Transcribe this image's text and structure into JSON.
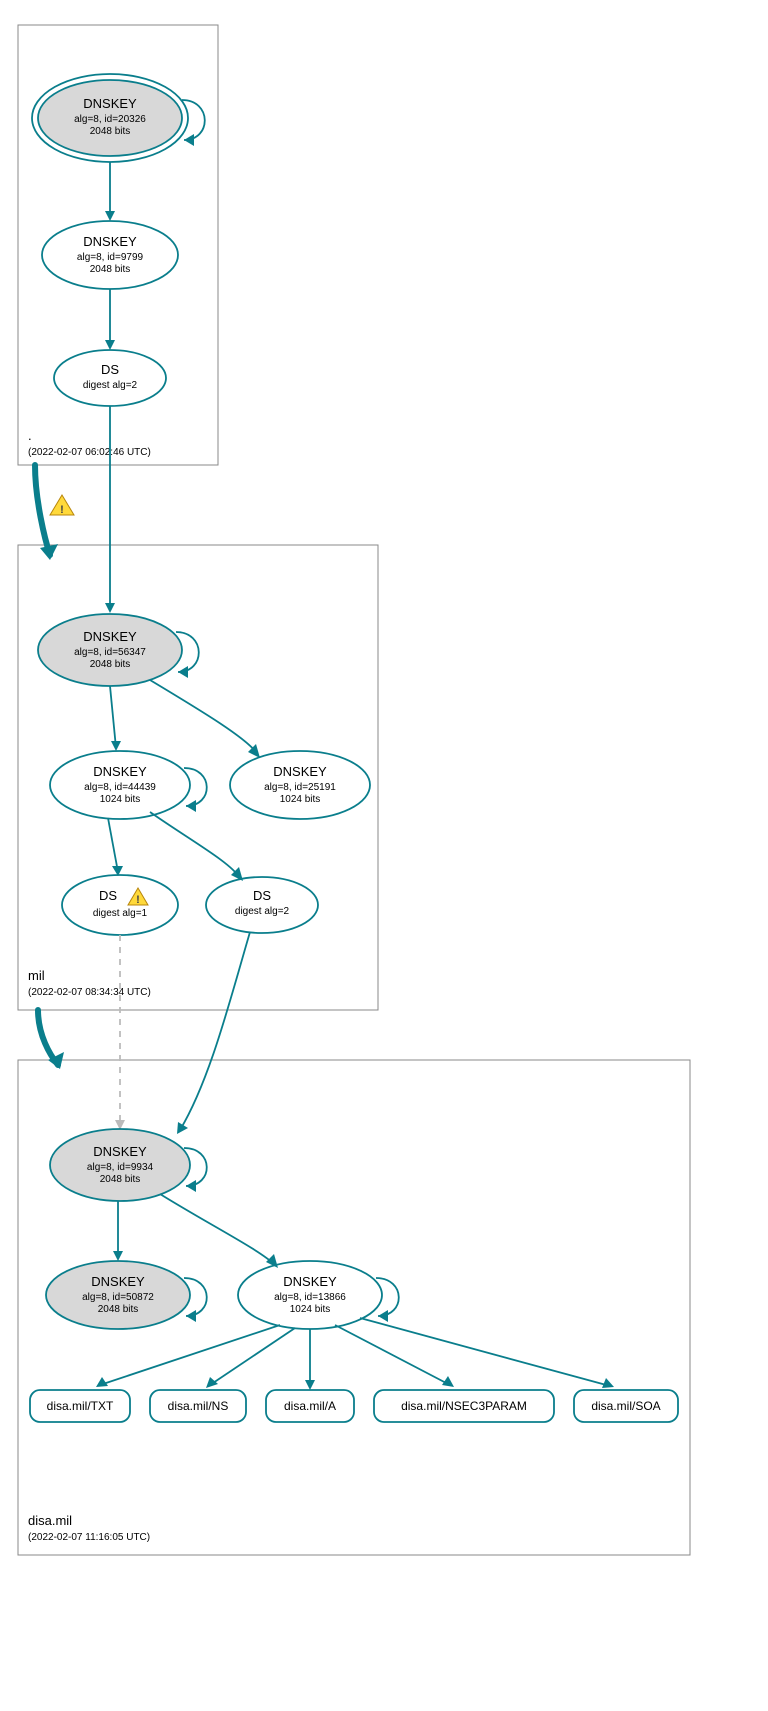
{
  "zones": [
    {
      "id": "root",
      "label": ".",
      "time": "(2022-02-07 06:02:46 UTC)"
    },
    {
      "id": "mil",
      "label": "mil",
      "time": "(2022-02-07 08:34:34 UTC)"
    },
    {
      "id": "disa",
      "label": "disa.mil",
      "time": "(2022-02-07 11:16:05 UTC)"
    }
  ],
  "nodes": {
    "root_ksk": {
      "title": "DNSKEY",
      "l1": "alg=8, id=20326",
      "l2": "2048 bits"
    },
    "root_zsk": {
      "title": "DNSKEY",
      "l1": "alg=8, id=9799",
      "l2": "2048 bits"
    },
    "root_ds": {
      "title": "DS",
      "l1": "digest alg=2",
      "l2": ""
    },
    "mil_ksk": {
      "title": "DNSKEY",
      "l1": "alg=8, id=56347",
      "l2": "2048 bits"
    },
    "mil_zsk1": {
      "title": "DNSKEY",
      "l1": "alg=8, id=44439",
      "l2": "1024 bits"
    },
    "mil_zsk2": {
      "title": "DNSKEY",
      "l1": "alg=8, id=25191",
      "l2": "1024 bits"
    },
    "mil_ds1": {
      "title": "DS",
      "l1": "digest alg=1",
      "l2": ""
    },
    "mil_ds2": {
      "title": "DS",
      "l1": "digest alg=2",
      "l2": ""
    },
    "disa_ksk": {
      "title": "DNSKEY",
      "l1": "alg=8, id=9934",
      "l2": "2048 bits"
    },
    "disa_k2": {
      "title": "DNSKEY",
      "l1": "alg=8, id=50872",
      "l2": "2048 bits"
    },
    "disa_zsk": {
      "title": "DNSKEY",
      "l1": "alg=8, id=13866",
      "l2": "1024 bits"
    }
  },
  "records": {
    "txt": "disa.mil/TXT",
    "ns": "disa.mil/NS",
    "a": "disa.mil/A",
    "nsec3": "disa.mil/NSEC3PARAM",
    "soa": "disa.mil/SOA"
  },
  "colors": {
    "stroke": "#0a7e8c",
    "shade": "#d8d8d8"
  }
}
